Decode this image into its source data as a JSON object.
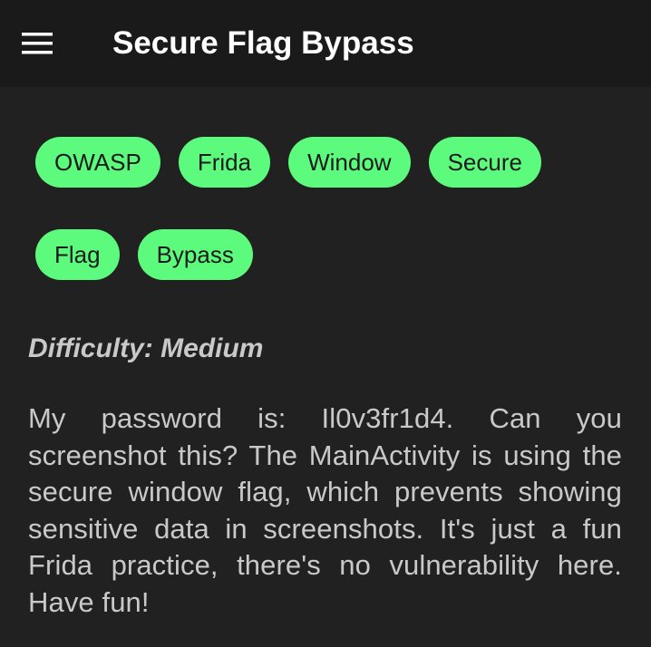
{
  "app_bar": {
    "title": "Secure Flag Bypass",
    "menu_icon": "hamburger-menu-icon"
  },
  "colors": {
    "background": "#212121",
    "app_bar": "#1a1a1a",
    "chip": "#5cfa7d",
    "chip_text": "#1c1c1c",
    "body_text": "#c9c9c9",
    "title_text": "#ffffff"
  },
  "tags": [
    {
      "label": "OWASP"
    },
    {
      "label": "Frida"
    },
    {
      "label": "Window"
    },
    {
      "label": "Secure"
    },
    {
      "label": "Flag"
    },
    {
      "label": "Bypass"
    }
  ],
  "difficulty": "Difficulty: Medium",
  "description": "My password is: Il0v3fr1d4. Can you screenshot this? The MainActivity is using the secure window flag, which prevents showing sensitive data in screenshots. It's just a fun Frida practice, there's no vulnerability here. Have fun!"
}
